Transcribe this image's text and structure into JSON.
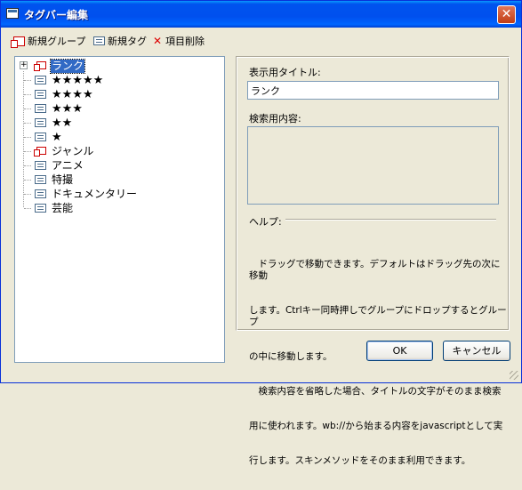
{
  "window": {
    "title": "タグバー編集",
    "close_label": "✕"
  },
  "toolbar": {
    "new_group": "新規グループ",
    "new_tag": "新規タグ",
    "delete": "項目削除"
  },
  "tree": {
    "root": {
      "label": "ランク",
      "expander": "+"
    },
    "items": [
      {
        "label": "★★★★★",
        "type": "tag"
      },
      {
        "label": "★★★★",
        "type": "tag"
      },
      {
        "label": "★★★",
        "type": "tag"
      },
      {
        "label": "★★",
        "type": "tag"
      },
      {
        "label": "★",
        "type": "tag"
      },
      {
        "label": "ジャンル",
        "type": "group"
      },
      {
        "label": "アニメ",
        "type": "tag"
      },
      {
        "label": "特撮",
        "type": "tag"
      },
      {
        "label": "ドキュメンタリー",
        "type": "tag"
      },
      {
        "label": "芸能",
        "type": "tag"
      }
    ]
  },
  "form": {
    "display_title_label": "表示用タイトル:",
    "display_title_value": "ランク",
    "search_content_label": "検索用内容:",
    "search_content_value": ""
  },
  "help": {
    "header": "ヘルプ:",
    "lines": [
      "　ドラッグで移動できます。デフォルトはドラッグ先の次に移動",
      "します。Ctrlキー同時押しでグループにドロップするとグループ",
      "の中に移動します。",
      "　検索内容を省略した場合、タイトルの文字がそのまま検索",
      "用に使われます。wb://から始まる内容をjavascriptとして実",
      "行します。スキンメソッドをそのまま利用できます。"
    ]
  },
  "buttons": {
    "ok": "OK",
    "cancel": "キャンセル"
  },
  "colors": {
    "titlebar": "#0053ee",
    "selection": "#316ac5",
    "window_bg": "#ece9d8"
  }
}
